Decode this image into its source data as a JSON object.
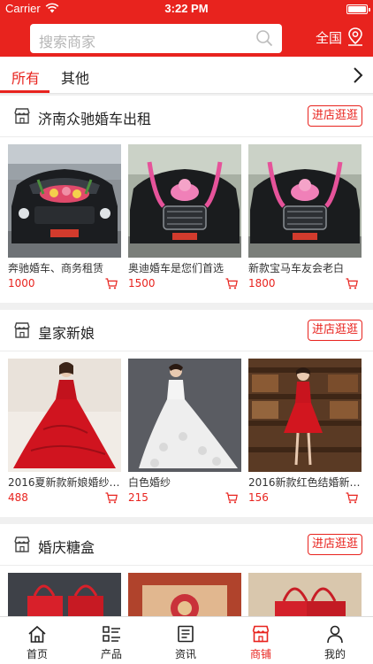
{
  "status_bar": {
    "carrier": "Carrier",
    "time": "3:22 PM"
  },
  "header": {
    "search_placeholder": "搜索商家",
    "region": "全国",
    "accent_color": "#e8231e"
  },
  "tabs": [
    {
      "label": "所有",
      "active": true
    },
    {
      "label": "其他",
      "active": false
    }
  ],
  "shops": [
    {
      "name": "济南众驰婚车出租",
      "button": "进店逛逛",
      "products": [
        {
          "title": "奔驰婚车、商务租赁",
          "price": "1000"
        },
        {
          "title": "奥迪婚车是您们首选",
          "price": "1500"
        },
        {
          "title": "新款宝马车友会老白",
          "price": "1800"
        }
      ]
    },
    {
      "name": "皇家新娘",
      "button": "进店逛逛",
      "products": [
        {
          "title": "2016夏新款新娘婚纱…",
          "price": "488"
        },
        {
          "title": "白色婚纱",
          "price": "215"
        },
        {
          "title": "2016新款红色结婚新…",
          "price": "156"
        }
      ]
    },
    {
      "name": "婚庆糖盒",
      "button": "进店逛逛",
      "products": []
    }
  ],
  "tabbar": [
    {
      "label": "首页",
      "icon": "home-icon",
      "active": false
    },
    {
      "label": "产品",
      "icon": "grid-list-icon",
      "active": false
    },
    {
      "label": "资讯",
      "icon": "news-icon",
      "active": false
    },
    {
      "label": "商铺",
      "icon": "shop-icon",
      "active": true
    },
    {
      "label": "我的",
      "icon": "user-icon",
      "active": false
    }
  ]
}
